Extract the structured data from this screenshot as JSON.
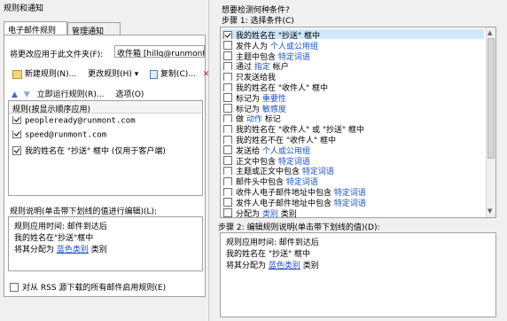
{
  "left": {
    "window_title": "规则和通知",
    "tabs": [
      {
        "label": "电子邮件规则"
      },
      {
        "label": "管理通知"
      }
    ],
    "apply_label": "将更改应用于此文件夹(F):",
    "folder_value": "收件箱 [hillq@runmont.com",
    "toolbar": {
      "new_rule": "新建规则(N)...",
      "change_rule": "更改规则(H) ▾",
      "copy": "复制(C)...",
      "run_now": "立即运行规则(R)...",
      "options": "选项(O)"
    },
    "rules_header": "规则(按显示顺序应用)",
    "rules": [
      {
        "name": "peopleready@runmont.com",
        "checked": true
      },
      {
        "name": "speed@runmont.com",
        "checked": true
      },
      {
        "name": "我的姓名在 \"抄送\" 框中  (仅用于客户端)",
        "checked": true
      }
    ],
    "desc_label": "规则说明(单击带下划线的值进行编辑)(L):",
    "desc_lines": [
      {
        "text": "规则应用时间: 邮件到达后"
      },
      {
        "text": "我的姓名在\"抄送\"框中"
      }
    ],
    "desc_line3_prefix": "将其分配为 ",
    "desc_line3_link": "蓝色类别",
    "desc_line3_suffix": " 类别",
    "rss_label": "对从 RSS 源下载的所有邮件启用规则(E)"
  },
  "right": {
    "question": "想要检测何种条件?",
    "step1_label": "步骤 1: 选择条件(C)",
    "conditions": [
      {
        "text": "我的姓名在 \"抄送\" 框中",
        "checked": true
      },
      {
        "before": "发件人为 ",
        "link": "个人或公用组",
        "after": "",
        "checked": false
      },
      {
        "before": "主题中包含 ",
        "link": "特定词语",
        "after": "",
        "checked": false
      },
      {
        "before": "通过 ",
        "link": "指定",
        "after": " 帐户",
        "checked": false
      },
      {
        "text": "只发送给我",
        "checked": false
      },
      {
        "text": "我的姓名在 \"收件人\" 框中",
        "checked": false
      },
      {
        "before": "标记为 ",
        "link": "重要性",
        "after": "",
        "checked": false
      },
      {
        "before": "标记为 ",
        "link": "敏感度",
        "after": "",
        "checked": false
      },
      {
        "before": "做 ",
        "link": "动作",
        "after": " 标记",
        "checked": false
      },
      {
        "text": "我的姓名在 \"收件人\" 或 \"抄送\" 框中",
        "checked": false
      },
      {
        "text": "我的姓名不在 \"收件人\" 框中",
        "checked": false
      },
      {
        "before": "发送给 ",
        "link": "个人或公用组",
        "after": "",
        "checked": false
      },
      {
        "before": "正文中包含 ",
        "link": "特定词语",
        "after": "",
        "checked": false
      },
      {
        "before": "主题或正文中包含 ",
        "link": "特定词语",
        "after": "",
        "checked": false
      },
      {
        "before": "邮件头中包含 ",
        "link": "特定词语",
        "after": "",
        "checked": false
      },
      {
        "before": "收件人电子邮件地址中包含 ",
        "link": "特定词语",
        "after": "",
        "checked": false
      },
      {
        "before": "发件人电子邮件地址中包含 ",
        "link": "特定词语",
        "after": "",
        "checked": false
      },
      {
        "before": "分配为 ",
        "link": "类别",
        "after": " 类别",
        "checked": false
      }
    ],
    "step2_label": "步骤 2: 编辑规则说明(单击带下划线的值)(D):",
    "step2_lines": [
      {
        "text": "规则应用时间: 邮件到达后"
      },
      {
        "text": "我的姓名在 \"抄送\" 框中"
      }
    ],
    "step2_line3_prefix": "将其分配为 ",
    "step2_line3_link": "蓝色类别",
    "step2_line3_suffix": " 类别"
  },
  "colors": {
    "link": "#1f4fd1",
    "selection": "#cde8ff",
    "window_bg": "#f0f0f0"
  }
}
